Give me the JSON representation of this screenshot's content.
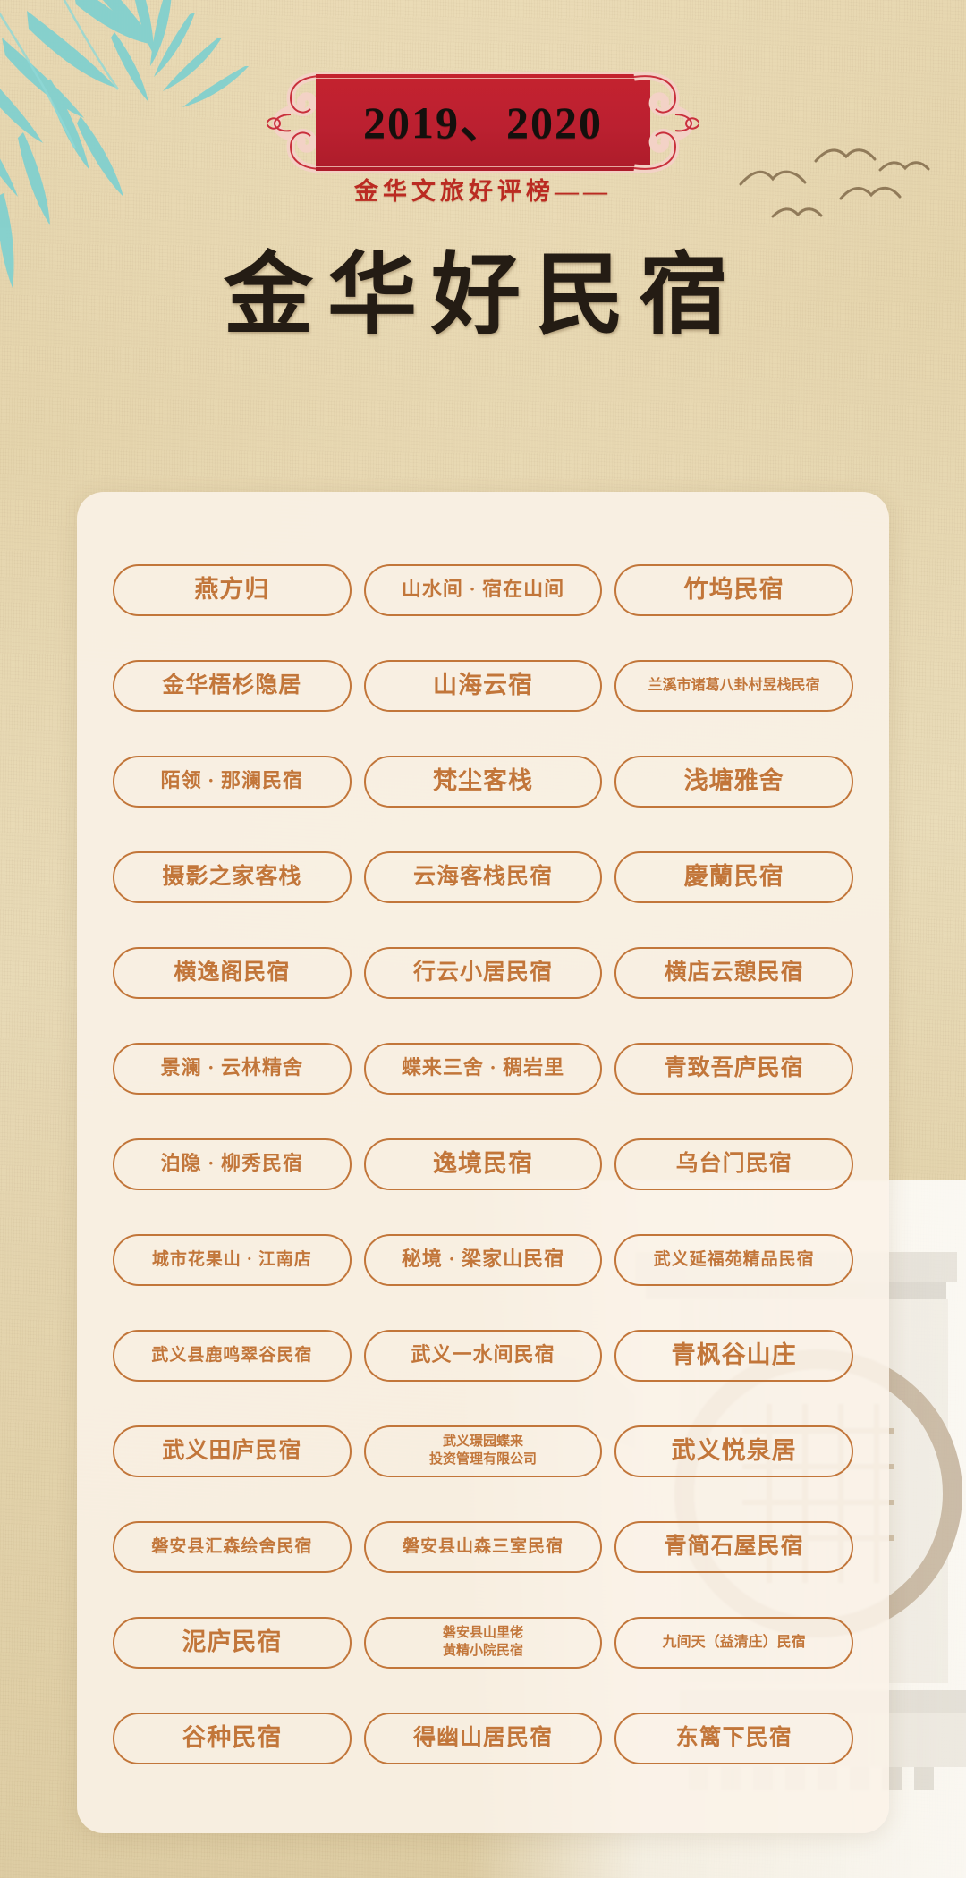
{
  "banner": {
    "years": "2019、2020",
    "subtitle": "金华文旅好评榜——",
    "title": "金华好民宿"
  },
  "colors": {
    "banner_red": "#bb2030",
    "subtitle_red": "#bb2b22",
    "pill_orange": "#c2763a",
    "title_dark": "#241c14",
    "paper": "#e5d5ae",
    "card": "#faf3e8",
    "bamboo_teal": "#6fc9c9"
  },
  "decor": {
    "bamboo": "bamboo-leaves-decoration",
    "birds": "flying-birds-decoration",
    "scroll_left": "scroll-ornament-left",
    "scroll_right": "scroll-ornament-right",
    "photo": "architecture-photo-watermark"
  },
  "list": {
    "rows": [
      [
        {
          "text": "燕方归",
          "size": "s-xl"
        },
        {
          "text": "山水间 · 宿在山间",
          "size": "s-md"
        },
        {
          "text": "竹坞民宿",
          "size": "s-xl"
        }
      ],
      [
        {
          "text": "金华梧杉隐居",
          "size": "s-lg"
        },
        {
          "text": "山海云宿",
          "size": "s-xl"
        },
        {
          "text": "兰溪市诸葛八卦村昱栈民宿",
          "size": "s-xs"
        }
      ],
      [
        {
          "text": "陌领 · 那澜民宿",
          "size": "s-md"
        },
        {
          "text": "梵尘客栈",
          "size": "s-xl"
        },
        {
          "text": "浅塘雅舍",
          "size": "s-xl"
        }
      ],
      [
        {
          "text": "摄影之家客栈",
          "size": "s-lg"
        },
        {
          "text": "云海客栈民宿",
          "size": "s-lg"
        },
        {
          "text": "慶蘭民宿",
          "size": "s-xl"
        }
      ],
      [
        {
          "text": "横逸阁民宿",
          "size": "s-lg"
        },
        {
          "text": "行云小居民宿",
          "size": "s-lg"
        },
        {
          "text": "横店云憩民宿",
          "size": "s-lg"
        }
      ],
      [
        {
          "text": "景澜 · 云林精舍",
          "size": "s-md"
        },
        {
          "text": "蝶来三舍 · 稠岩里",
          "size": "s-md"
        },
        {
          "text": "青致吾庐民宿",
          "size": "s-lg"
        }
      ],
      [
        {
          "text": "泊隐 · 柳秀民宿",
          "size": "s-md"
        },
        {
          "text": "逸境民宿",
          "size": "s-xl"
        },
        {
          "text": "乌台门民宿",
          "size": "s-lg"
        }
      ],
      [
        {
          "text": "城市花果山 · 江南店",
          "size": "s-sm"
        },
        {
          "text": "秘境 · 梁家山民宿",
          "size": "s-md"
        },
        {
          "text": "武义延福苑精品民宿",
          "size": "s-sm"
        }
      ],
      [
        {
          "text": "武义县鹿鸣翠谷民宿",
          "size": "s-sm"
        },
        {
          "text": "武义一水间民宿",
          "size": "s-md"
        },
        {
          "text": "青枫谷山庄",
          "size": "s-xl"
        }
      ],
      [
        {
          "text": "武义田庐民宿",
          "size": "s-lg"
        },
        {
          "text": "武义璟园蝶来\n投资管理有限公司",
          "size": "two-line"
        },
        {
          "text": "武义悦泉居",
          "size": "s-xl"
        }
      ],
      [
        {
          "text": "磐安县汇森绘舍民宿",
          "size": "s-sm"
        },
        {
          "text": "磐安县山森三室民宿",
          "size": "s-sm"
        },
        {
          "text": "青简石屋民宿",
          "size": "s-lg"
        }
      ],
      [
        {
          "text": "泥庐民宿",
          "size": "s-xl"
        },
        {
          "text": "磐安县山里佬\n黄精小院民宿",
          "size": "two-line"
        },
        {
          "text": "九间天（益清庄）民宿",
          "size": "s-xs"
        }
      ],
      [
        {
          "text": "谷种民宿",
          "size": "s-xl"
        },
        {
          "text": "得幽山居民宿",
          "size": "s-lg"
        },
        {
          "text": "东篱下民宿",
          "size": "s-lg"
        }
      ]
    ]
  }
}
